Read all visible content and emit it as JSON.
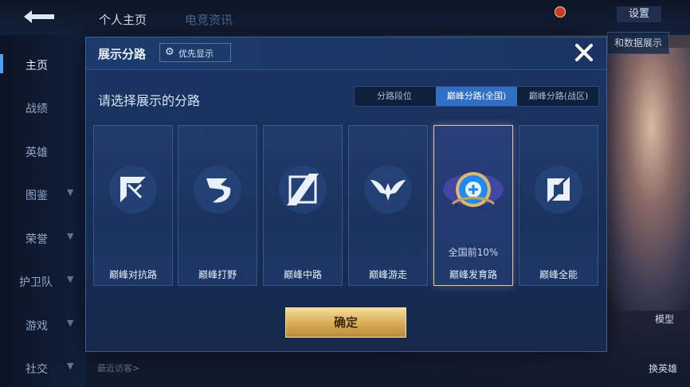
{
  "top_nav": {
    "tabs": [
      "个人主页",
      "电竞资讯"
    ],
    "settings_label": "设置"
  },
  "sidebar": {
    "items": [
      {
        "label": "主页",
        "active": true,
        "expandable": false
      },
      {
        "label": "战绩",
        "active": false,
        "expandable": false
      },
      {
        "label": "英雄",
        "active": false,
        "expandable": false
      },
      {
        "label": "图鉴",
        "active": false,
        "expandable": true
      },
      {
        "label": "荣誉",
        "active": false,
        "expandable": true
      },
      {
        "label": "护卫队",
        "active": false,
        "expandable": true
      },
      {
        "label": "游戏",
        "active": false,
        "expandable": true
      },
      {
        "label": "社交",
        "active": false,
        "expandable": true
      }
    ]
  },
  "recent_visitors_label": "最近访客>",
  "right_panel": {
    "data_button_label": "和数据展示",
    "model_label": "模型",
    "switch_hero_label": "换英雄"
  },
  "modal": {
    "title": "展示分路",
    "priority_label": "优先显示",
    "prompt": "请选择展示的分路",
    "tabs": [
      {
        "label": "分路段位",
        "active": false
      },
      {
        "label": "巅峰分路(全国)",
        "active": true
      },
      {
        "label": "巅峰分路(战区)",
        "active": false
      }
    ],
    "cards": [
      {
        "label": "巅峰对抗路",
        "icon": "clash-lane-icon",
        "rank": "",
        "selected": false
      },
      {
        "label": "巅峰打野",
        "icon": "jungle-dragon-icon",
        "rank": "",
        "selected": false
      },
      {
        "label": "巅峰中路",
        "icon": "mid-lane-icon",
        "rank": "",
        "selected": false
      },
      {
        "label": "巅峰游走",
        "icon": "roam-wings-icon",
        "rank": "",
        "selected": false
      },
      {
        "label": "巅峰发育路",
        "icon": "farm-lane-emblem-icon",
        "rank": "全国前10%",
        "selected": true
      },
      {
        "label": "巅峰全能",
        "icon": "all-round-icon",
        "rank": "",
        "selected": false
      }
    ],
    "confirm_label": "确定"
  },
  "colors": {
    "accent_blue": "#2f6fc6",
    "confirm_gold": "#d6ab55",
    "selected_border": "#e9c98a"
  }
}
